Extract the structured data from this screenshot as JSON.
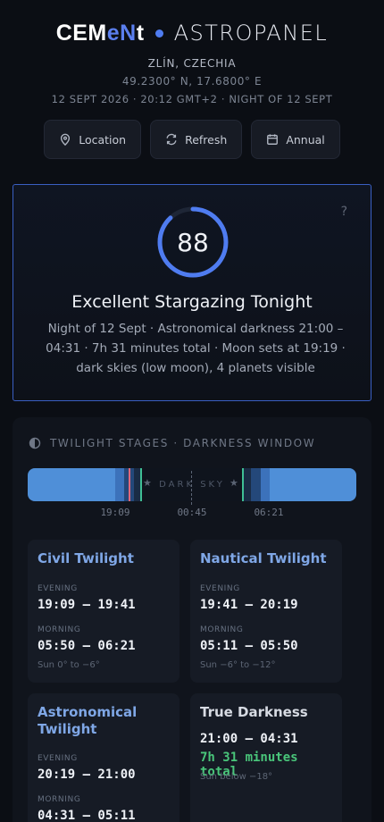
{
  "header": {
    "brand_pre": "CEM",
    "brand_mid": "eN",
    "brand_post": "t",
    "app_name": "ASTROPANEL",
    "place": "ZLÍN, CZECHIA",
    "coords": "49.2300° N, 17.6800° E",
    "datetime": "12 SEPT 2026 · 20:12 GMT+2 · NIGHT OF 12 SEPT"
  },
  "actions": [
    {
      "label": "Location",
      "icon": "pin-icon"
    },
    {
      "label": "Refresh",
      "icon": "refresh-icon"
    },
    {
      "label": "Annual",
      "icon": "calendar-icon"
    }
  ],
  "score": {
    "value": "88",
    "fraction": 0.88,
    "help": "?",
    "verdict": "Excellent Stargazing Tonight",
    "summary": "Night of 12 Sept · Astronomical darkness 21:00 – 04:31 · 7h 31 minutes total · Moon sets at 19:19 · dark skies (low moon), 4 planets visible",
    "accent": "#4f7cf0"
  },
  "twilight": {
    "heading": "TWILIGHT STAGES · DARKNESS WINDOW",
    "dark_label": "DARK SKY",
    "star": "★",
    "ticks": [
      "19:09",
      "00:45",
      "06:21"
    ],
    "cards": {
      "civil": {
        "title": "Civil Twilight",
        "evening_label": "EVENING",
        "evening": "19:09 – 19:41",
        "morning_label": "MORNING",
        "morning": "05:50 – 06:21",
        "note": "Sun 0° to −6°"
      },
      "nautical": {
        "title": "Nautical Twilight",
        "evening_label": "EVENING",
        "evening": "19:41 – 20:19",
        "morning_label": "MORNING",
        "morning": "05:11 – 05:50",
        "note": "Sun −6° to −12°"
      },
      "astronomical": {
        "title": "Astronomical Twilight",
        "evening_label": "EVENING",
        "evening": "20:19 – 21:00",
        "morning_label": "MORNING",
        "morning": "04:31 – 05:11"
      },
      "darkness": {
        "title": "True Darkness",
        "range": "21:00 – 04:31",
        "total": "7h 31 minutes total",
        "note": "Sun below −18°"
      }
    }
  }
}
